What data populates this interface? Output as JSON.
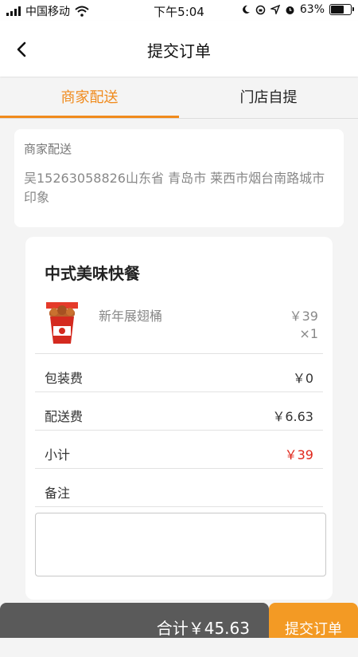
{
  "status_bar": {
    "carrier": "中国移动",
    "time": "下午5:04",
    "battery": "63%",
    "icons": [
      "signal-icon",
      "wifi-icon",
      "moon-icon",
      "rotation-lock-icon",
      "location-icon",
      "alarm-icon",
      "battery-icon"
    ]
  },
  "header": {
    "title": "提交订单",
    "back_icon": "chevron-left-icon"
  },
  "tabs": [
    {
      "label": "商家配送",
      "active": true
    },
    {
      "label": "门店自提",
      "active": false
    }
  ],
  "address": {
    "mode": "商家配送",
    "text": "吴15263058826山东省 青岛市 莱西市烟台南路城市印象"
  },
  "order": {
    "shop_name": "中式美味快餐",
    "product": {
      "name": "新年展翅桶",
      "price": "￥39",
      "quantity": "×1"
    },
    "rows": [
      {
        "label": "包装费",
        "value": "￥0"
      },
      {
        "label": "配送费",
        "value": "￥6.63"
      },
      {
        "label": "小计",
        "value": "￥39"
      },
      {
        "label": "备注",
        "value": ""
      }
    ],
    "note_placeholder": ""
  },
  "bottom": {
    "total": "合计￥45.63",
    "submit_label": "提交订单"
  },
  "colors": {
    "accent": "#f08a1c",
    "price_red": "#e0261a",
    "total_bar": "#5a5a5a",
    "submit": "#f39a24"
  }
}
